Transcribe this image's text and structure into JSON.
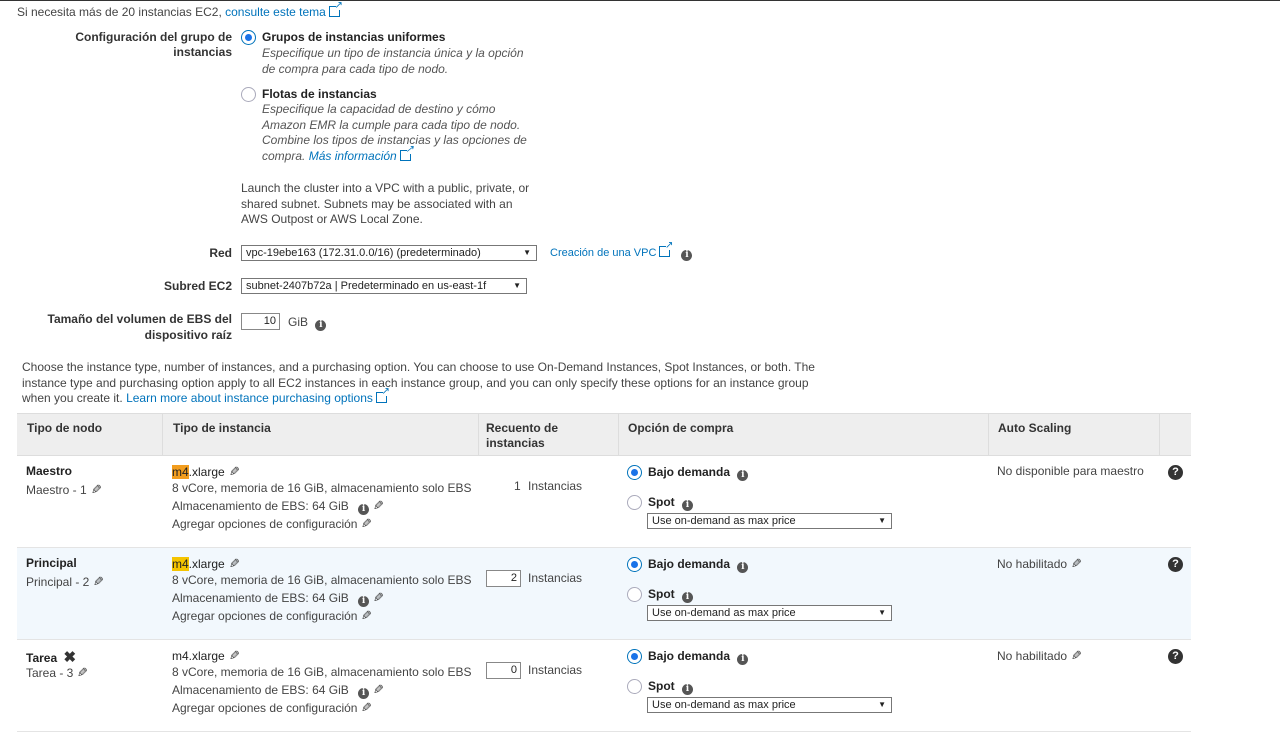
{
  "top_note": {
    "text": "Si necesita más de 20 instancias EC2,",
    "link": "consulte este tema"
  },
  "group_config": {
    "label": "Configuración del grupo de instancias",
    "options": [
      {
        "title": "Grupos de instancias uniformes",
        "desc": "Especifique un tipo de instancia única y la opción de compra para cada tipo de nodo.",
        "selected": true
      },
      {
        "title": "Flotas de instancias",
        "desc": "Especifique la capacidad de destino y cómo Amazon EMR la cumple para cada tipo de nodo. Combine los tipos de instancias y las opciones de compra.",
        "link": "Más información",
        "selected": false
      }
    ]
  },
  "vpc_note": "Launch the cluster into a VPC with a public, private, or shared subnet. Subnets may be associated with an AWS Outpost or AWS Local Zone.",
  "network": {
    "label": "Red",
    "value": "vpc-19ebe163 (172.31.0.0/16) (predeterminado)",
    "create_link": "Creación de una VPC"
  },
  "subnet": {
    "label": "Subred EC2",
    "value": "subnet-2407b72a | Predeterminado en us-east-1f"
  },
  "ebs_root": {
    "label": "Tamaño del volumen de EBS del dispositivo raíz",
    "value": "10",
    "unit": "GiB"
  },
  "purchase_note": {
    "text": "Choose the instance type, number of instances, and a purchasing option. You can choose to use On-Demand Instances, Spot Instances, or both. The instance type and purchasing option apply to all EC2 instances in each instance group, and you can only specify these options for an instance group when you create it.",
    "link": "Learn more about instance purchasing options"
  },
  "table": {
    "headers": [
      "Tipo de nodo",
      "Tipo de instancia",
      "Recuento de instancias",
      "Opción de compra",
      "Auto Scaling"
    ],
    "rows": [
      {
        "node": "Maestro",
        "sub": "Maestro - 1",
        "type_prefix": "m4",
        "type_suffix": ".xlarge",
        "spec": "8 vCore, memoria de 16 GiB, almacenamiento solo EBS",
        "storage": "Almacenamiento de EBS:  64 GiB",
        "config": "Agregar opciones de configuración",
        "count": "1",
        "count_unit": "Instancias",
        "on_demand": "Bajo demanda",
        "spot": "Spot",
        "price": "Use on-demand as max price",
        "autoscaling": "No disponible para maestro"
      },
      {
        "node": "Principal",
        "sub": "Principal - 2",
        "type_prefix": "m4",
        "type_suffix": ".xlarge",
        "spec": "8 vCore, memoria de 16 GiB, almacenamiento solo EBS",
        "storage": "Almacenamiento de EBS:  64 GiB",
        "config": "Agregar opciones de configuración",
        "count": "2",
        "count_unit": "Instancias",
        "on_demand": "Bajo demanda",
        "spot": "Spot",
        "price": "Use on-demand as max price",
        "autoscaling": "No habilitado"
      },
      {
        "node": "Tarea",
        "sub": "Tarea - 3",
        "type_prefix": "m4",
        "type_suffix": ".xlarge",
        "spec": "8 vCore, memoria de 16 GiB, almacenamiento solo EBS",
        "storage": "Almacenamiento de EBS:  64 GiB",
        "config": "Agregar opciones de configuración",
        "count": "0",
        "count_unit": "Instancias",
        "on_demand": "Bajo demanda",
        "spot": "Spot",
        "price": "Use on-demand as max price",
        "autoscaling": "No habilitado"
      }
    ]
  },
  "colors": {
    "link": "#0073bb",
    "radio_selected": "#1a73e8",
    "highlight_yellow": "#f5c400",
    "highlight_orange": "#f29d1e",
    "row_highlight": "#f2f8fd"
  }
}
